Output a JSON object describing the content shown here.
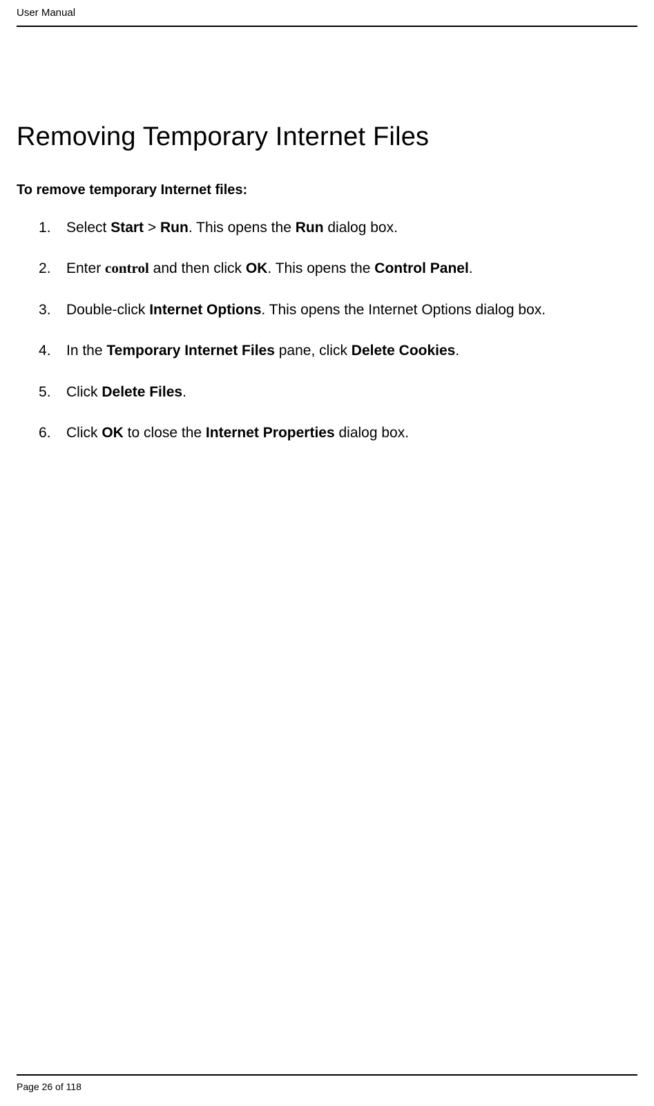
{
  "header": {
    "doc_title": "User Manual"
  },
  "main": {
    "title": "Removing Temporary Internet Files",
    "subheading": "To remove temporary Internet files:",
    "steps": [
      {
        "parts": [
          {
            "t": "Select "
          },
          {
            "t": "Start",
            "b": true
          },
          {
            "t": " > "
          },
          {
            "t": "Run",
            "b": true
          },
          {
            "t": ". This opens the "
          },
          {
            "t": "Run",
            "b": true
          },
          {
            "t": " dialog box."
          }
        ]
      },
      {
        "parts": [
          {
            "t": "Enter "
          },
          {
            "t": "control",
            "serif": true
          },
          {
            "t": " and then click "
          },
          {
            "t": "OK",
            "b": true
          },
          {
            "t": ". This opens the "
          },
          {
            "t": "Control Panel",
            "b": true
          },
          {
            "t": "."
          }
        ]
      },
      {
        "parts": [
          {
            "t": "Double-click "
          },
          {
            "t": "Internet Options",
            "b": true
          },
          {
            "t": ". This opens the Internet Options dialog box."
          }
        ]
      },
      {
        "parts": [
          {
            "t": "In the "
          },
          {
            "t": "Temporary Internet Files",
            "b": true
          },
          {
            "t": " pane, click "
          },
          {
            "t": "Delete Cookies",
            "b": true
          },
          {
            "t": "."
          }
        ]
      },
      {
        "parts": [
          {
            "t": "Click "
          },
          {
            "t": "Delete Files",
            "b": true
          },
          {
            "t": "."
          }
        ]
      },
      {
        "parts": [
          {
            "t": "Click "
          },
          {
            "t": "OK",
            "b": true
          },
          {
            "t": " to close the "
          },
          {
            "t": "Internet Properties",
            "b": true
          },
          {
            "t": " dialog box."
          }
        ]
      }
    ]
  },
  "footer": {
    "page_label_prefix": "Page ",
    "page_number": "26",
    "page_label_middle": " of ",
    "total_pages": "118"
  }
}
